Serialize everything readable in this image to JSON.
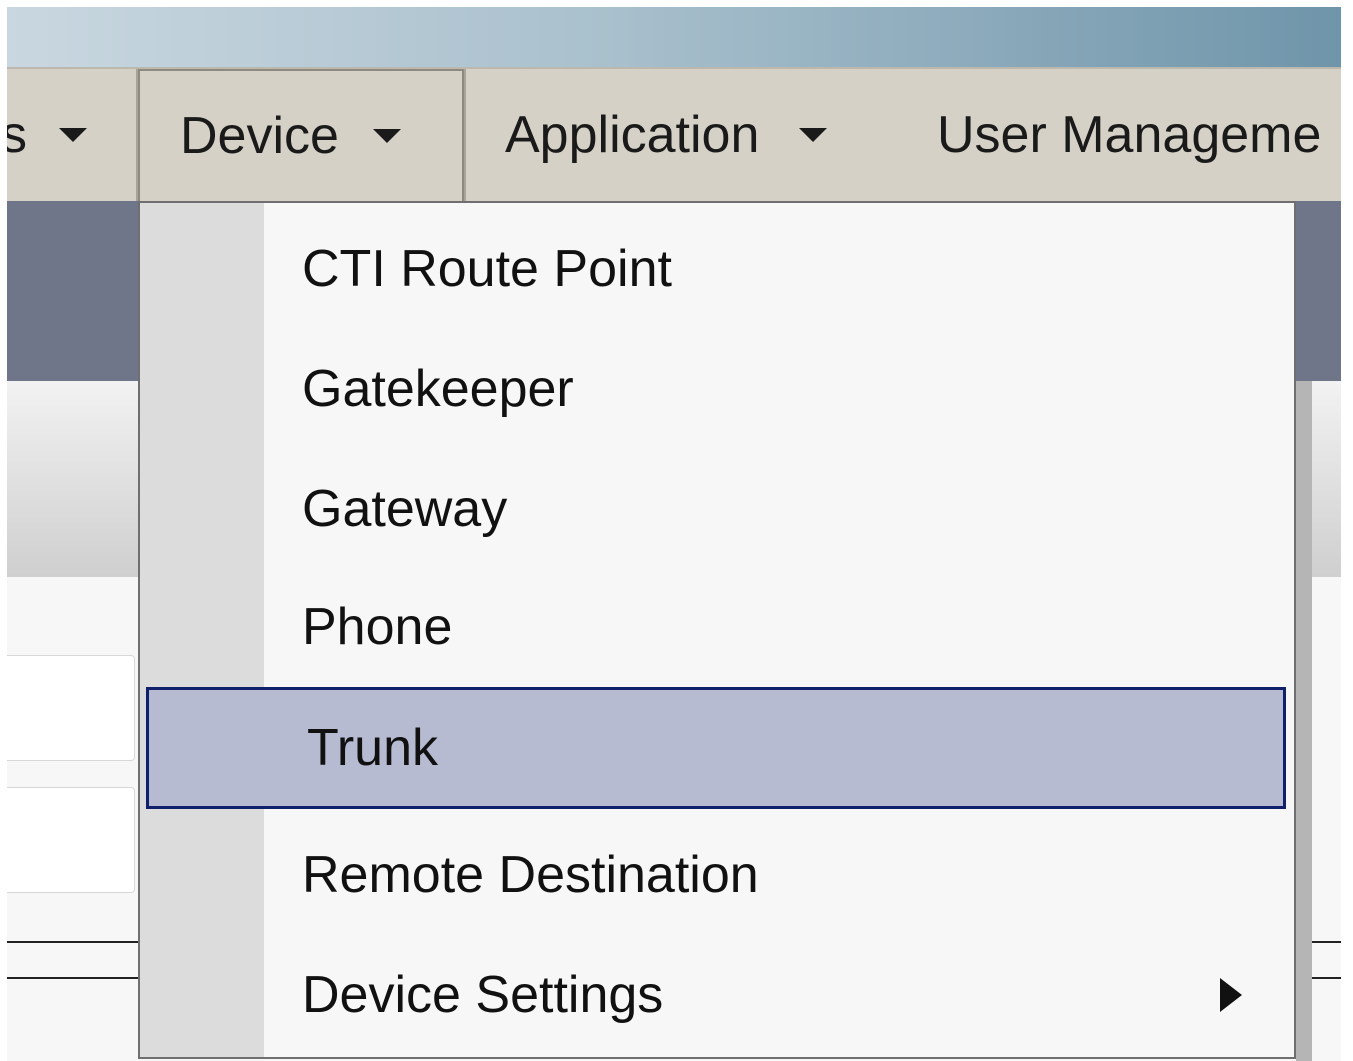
{
  "menubar": {
    "tabs": [
      {
        "label": "s"
      },
      {
        "label": "Device"
      },
      {
        "label": "Application"
      },
      {
        "label": "User Manageme"
      }
    ]
  },
  "device_menu": {
    "items": [
      {
        "label": "CTI Route Point"
      },
      {
        "label": "Gatekeeper"
      },
      {
        "label": "Gateway"
      },
      {
        "label": "Phone"
      },
      {
        "label": "Trunk",
        "selected": true
      },
      {
        "label": "Remote Destination"
      },
      {
        "label": "Device Settings",
        "has_submenu": true,
        "icon": "submenu-arrow-icon"
      }
    ]
  },
  "colors": {
    "menubar_bg": "#d6d1c6",
    "nav_band": "#707689",
    "selected_bg": "#b6bbd2",
    "selected_border": "#10206a"
  }
}
